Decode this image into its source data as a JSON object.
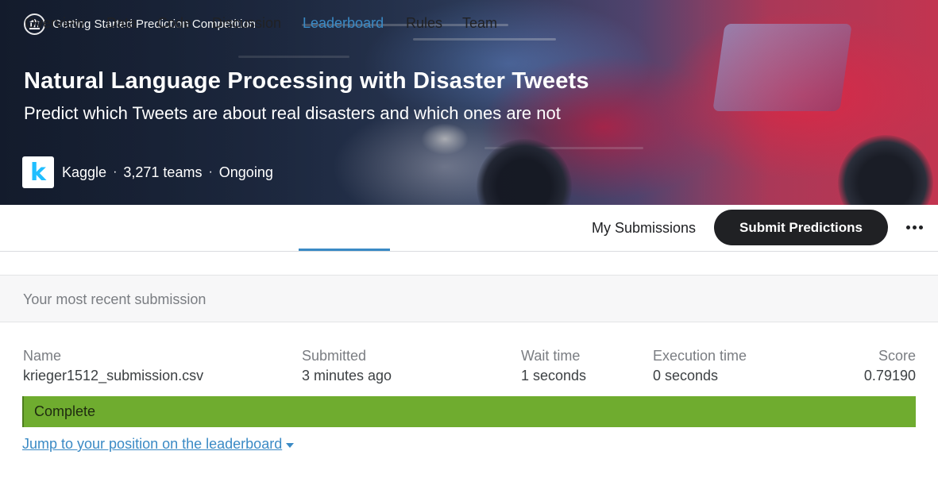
{
  "hero": {
    "competition_type": "Getting Started Prediction Competition",
    "competition_icon": "institution-icon",
    "title": "Natural Language Processing with Disaster Tweets",
    "subtitle": "Predict which Tweets are about real disasters and which ones are not",
    "host_logo_letter": "k",
    "host": "Kaggle",
    "teams": "3,271 teams",
    "status": "Ongoing",
    "separator": "·"
  },
  "tabs": [
    {
      "label": "Overview",
      "active": false
    },
    {
      "label": "Data",
      "active": false
    },
    {
      "label": "Code",
      "active": false
    },
    {
      "label": "Discussion",
      "active": false
    },
    {
      "label": "Leaderboard",
      "active": true
    },
    {
      "label": "Rules",
      "active": false
    },
    {
      "label": "Team",
      "active": false
    }
  ],
  "actions": {
    "my_submissions": "My Submissions",
    "submit_predictions": "Submit Predictions",
    "more_icon": "more-horizontal-icon"
  },
  "submission": {
    "section_title": "Your most recent submission",
    "columns": {
      "name": "Name",
      "submitted": "Submitted",
      "wait_time": "Wait time",
      "execution_time": "Execution time",
      "score": "Score"
    },
    "values": {
      "name": "krieger1512_submission.csv",
      "submitted": "3 minutes ago",
      "wait_time": "1 seconds",
      "execution_time": "0 seconds",
      "score": "0.79190"
    },
    "status": "Complete",
    "status_color": "#6fac2f",
    "jump_link": "Jump to your position on the leaderboard"
  },
  "colors": {
    "accent": "#3a8ac5",
    "button_dark": "#202124",
    "kaggle_blue": "#20beff"
  }
}
